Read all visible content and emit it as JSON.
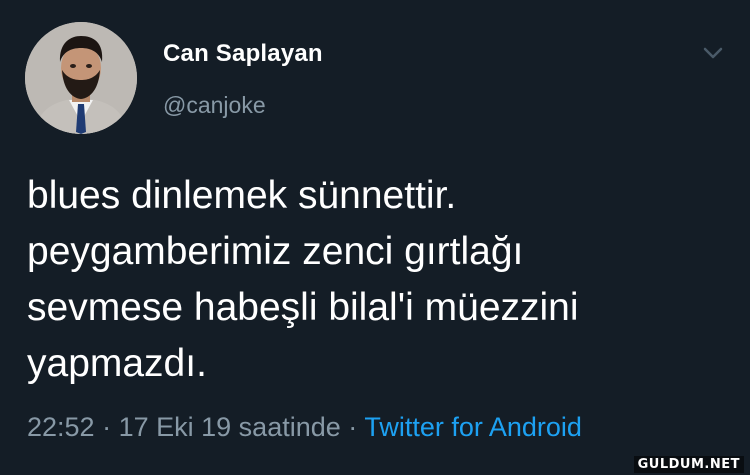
{
  "user": {
    "display_name": "Can Saplayan",
    "handle": "@canjoke"
  },
  "tweet": {
    "lines": [
      "blues dinlemek sünnettir.",
      "peygamberimiz zenci gırtlağı",
      "sevmese habeşli bilal'i müezzini",
      "yapmazdı."
    ],
    "time": "22:52",
    "separator": "·",
    "date": "17 Eki 19 saatinde",
    "source": "Twitter for Android"
  },
  "watermark": "GULDUM.NET",
  "icons": {
    "more": "chevron-down-icon"
  },
  "colors": {
    "background": "#141d26",
    "secondary_text": "#8899a6",
    "link": "#1da1f2"
  }
}
